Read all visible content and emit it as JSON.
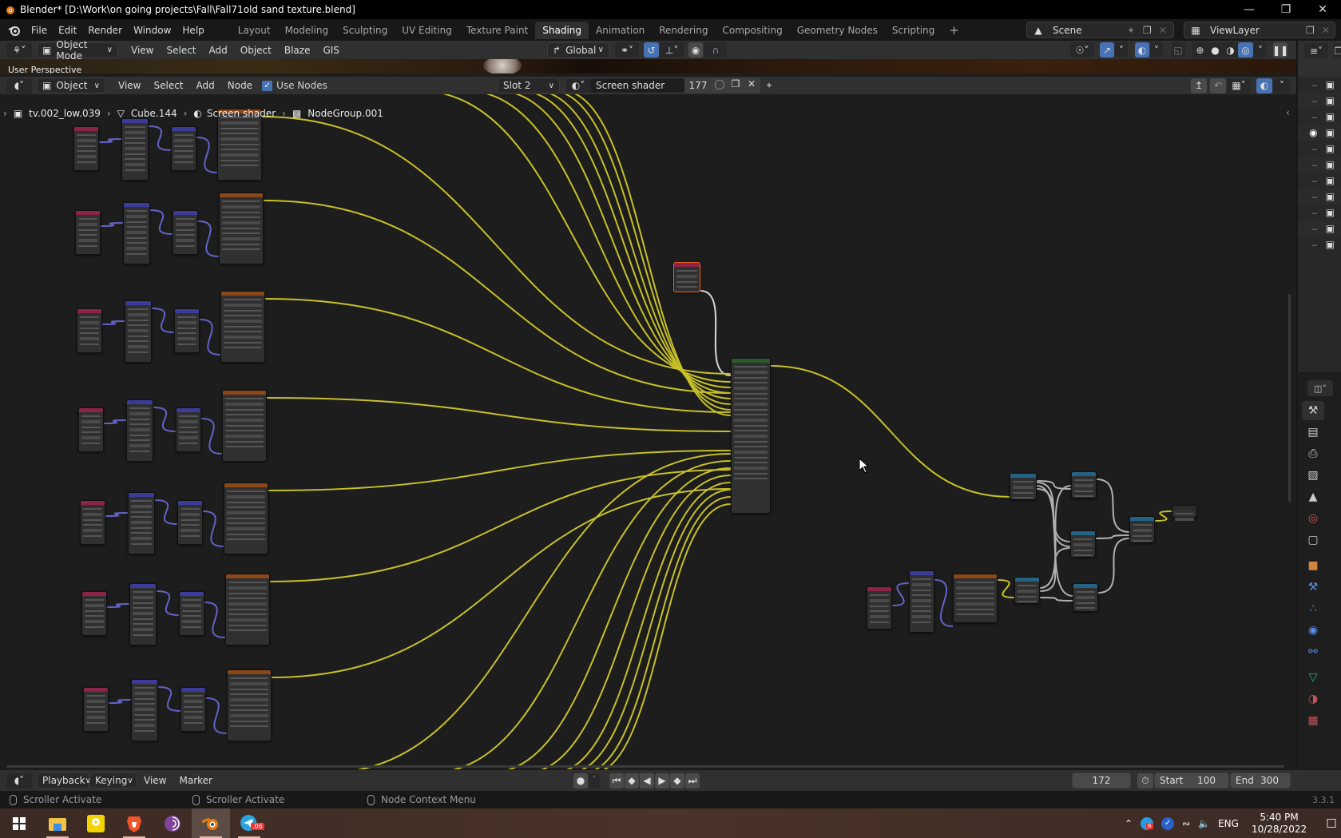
{
  "window": {
    "title": "Blender* [D:\\Work\\on going projects\\Fall\\Fall71old sand texture.blend]",
    "controls": [
      "minimize",
      "maximize",
      "close"
    ]
  },
  "menubar": {
    "menus": [
      "File",
      "Edit",
      "Render",
      "Window",
      "Help"
    ],
    "workspaces": [
      "Layout",
      "Modeling",
      "Sculpting",
      "UV Editing",
      "Texture Paint",
      "Shading",
      "Animation",
      "Rendering",
      "Compositing",
      "Geometry Nodes",
      "Scripting"
    ],
    "active_workspace": "Shading",
    "add_workspace": "+",
    "scene": "Scene",
    "view_layer": "ViewLayer"
  },
  "viewport_header": {
    "mode": "Object Mode",
    "menus": [
      "View",
      "Select",
      "Add",
      "Object",
      "Blaze",
      "GIS"
    ],
    "transform_orientation": "Global",
    "overlay_label": "User Perspective"
  },
  "node_editor": {
    "header": {
      "object_mode": "Object",
      "menus": [
        "View",
        "Select",
        "Add",
        "Node"
      ],
      "use_nodes_label": "Use Nodes",
      "use_nodes_checked": true,
      "slot": "Slot 2",
      "material_name": "Screen shader",
      "user_count": "177"
    },
    "breadcrumb": [
      "tv.002_low.039",
      "Cube.144",
      "Screen shader",
      "NodeGroup.001"
    ],
    "wire_colors": {
      "color": "#c7c02a",
      "vector": "#6363c7",
      "shader": "#b0b0b0"
    }
  },
  "timeline": {
    "menus": [
      "Playback",
      "Keying",
      "View",
      "Marker"
    ],
    "current_frame": "172",
    "start_label": "Start",
    "start": "100",
    "end_label": "End",
    "end": "300"
  },
  "statusbar": {
    "hints": [
      "Scroller Activate",
      "Scroller Activate",
      "Node Context Menu"
    ],
    "version": "3.3.1"
  },
  "taskbar": {
    "apps": [
      "Start",
      "File Explorer",
      "Player",
      "Brave",
      "Tor Browser",
      "Blender",
      "Telegram"
    ],
    "telegram_badge": ".06",
    "tray_badge": "6",
    "language": "ENG",
    "time": "5:40 PM",
    "date": "10/28/2022"
  },
  "outliner": {
    "rows": [
      {
        "visible": false
      },
      {
        "visible": false
      },
      {
        "visible": false
      },
      {
        "visible": true
      },
      {
        "visible": false
      },
      {
        "visible": false
      },
      {
        "visible": false
      },
      {
        "visible": false
      },
      {
        "visible": false
      },
      {
        "visible": false
      },
      {
        "visible": false
      }
    ]
  },
  "properties_tabs": [
    "tool",
    "render",
    "output",
    "view-layer",
    "scene",
    "world",
    "collection",
    "object",
    "modifier",
    "particles",
    "physics",
    "constraints",
    "data",
    "material",
    "texture"
  ]
}
